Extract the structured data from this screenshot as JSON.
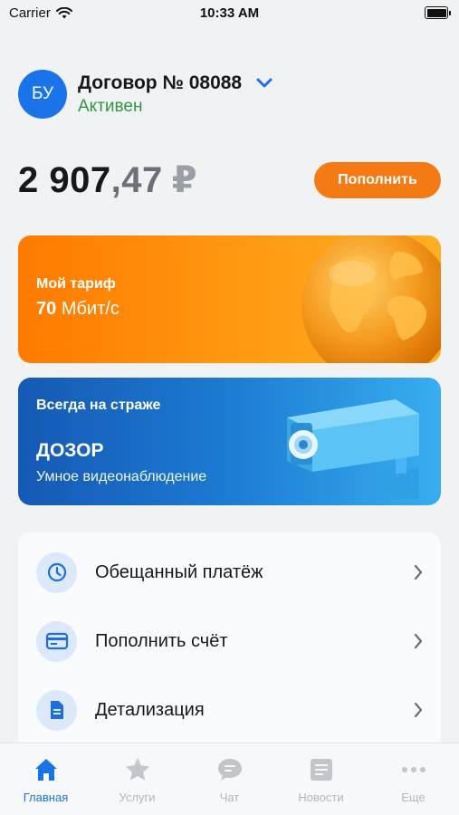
{
  "status_bar": {
    "carrier": "Carrier",
    "time": "10:33 AM"
  },
  "account": {
    "avatar_initials": "БУ",
    "contract_title": "Договор № 08088",
    "status": "Активен"
  },
  "balance": {
    "whole": "2 907",
    "fraction": ",47",
    "currency": "₽"
  },
  "topup_button": "Пополнить",
  "tariff_card": {
    "label": "Мой тариф",
    "speed_value": "70",
    "speed_unit": "Мбит/с"
  },
  "dozor_card": {
    "kicker": "Всегда на страже",
    "title": "ДОЗОР",
    "subtitle": "Умное видеонаблюдение"
  },
  "menu": [
    {
      "label": "Обещанный платёж",
      "icon": "clock-icon"
    },
    {
      "label": "Пополнить счёт",
      "icon": "credit-card-icon"
    },
    {
      "label": "Детализация",
      "icon": "document-icon"
    }
  ],
  "tabs": [
    {
      "label": "Главная",
      "icon": "home-icon",
      "active": true
    },
    {
      "label": "Услуги",
      "icon": "star-icon",
      "active": false
    },
    {
      "label": "Чат",
      "icon": "chat-icon",
      "active": false
    },
    {
      "label": "Новости",
      "icon": "news-icon",
      "active": false
    },
    {
      "label": "Еще",
      "icon": "more-icon",
      "active": false
    }
  ],
  "colors": {
    "accent_blue": "#1a73e8",
    "accent_orange": "#f47b14",
    "active_green": "#2e9a3e",
    "inactive_tab": "#b3b6bb"
  }
}
